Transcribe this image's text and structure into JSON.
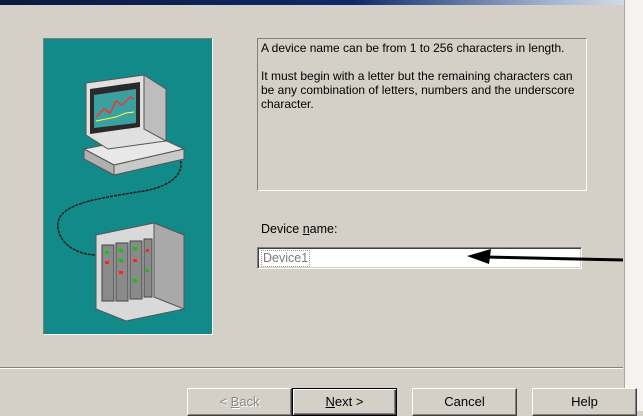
{
  "info": {
    "line1": "A device name can be from 1 to 256 characters in length.",
    "line2": "It must begin with a letter but the remaining characters can be any combination of letters, numbers and the underscore character."
  },
  "device_name": {
    "label_before": "Device ",
    "label_accel": "n",
    "label_after": "ame:",
    "value": "Device1"
  },
  "buttons": {
    "back_symbol": "< ",
    "back_accel": "B",
    "back_rest": "ack",
    "next_accel": "N",
    "next_rest": "ext >",
    "cancel": "Cancel",
    "help": "Help"
  },
  "colors": {
    "panel_teal": "#138a8a",
    "dialog_bg": "#d4d0c8"
  }
}
